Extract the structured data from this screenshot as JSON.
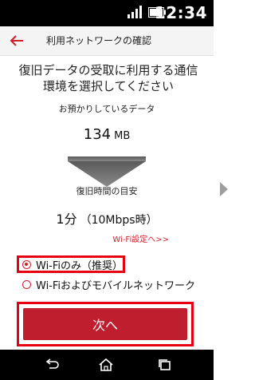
{
  "status_bar": {
    "time": "12:34",
    "signal_icon": "signal-icon",
    "battery_icon": "battery-icon"
  },
  "app_bar": {
    "back_icon": "back-arrow-icon",
    "title": "利用ネットワークの確認"
  },
  "main": {
    "lead_line1": "復旧データの受取に利用する通信",
    "lead_line2": "環境を選択してください",
    "stored_data_label": "お預かりしているデータ",
    "stored_data_value": "134",
    "stored_data_unit": "MB",
    "restore_time_label": "復旧時間の目安",
    "restore_time_value": "1分",
    "restore_time_speed": "（10Mbps時）",
    "wifi_settings_link": "Wi-Fi設定へ>>",
    "options": [
      {
        "label": "Wi-Fiのみ（推奨）",
        "selected": true
      },
      {
        "label": "Wi-Fiおよびモバイルネットワーク",
        "selected": false
      }
    ],
    "next_button": "次へ"
  },
  "nav_bar": {
    "back_icon": "nav-back-icon",
    "home_icon": "nav-home-icon",
    "recent_icon": "nav-recent-apps-icon"
  },
  "colors": {
    "accent": "#be1e2d",
    "highlight": "#e60012",
    "link": "#d0202a"
  }
}
